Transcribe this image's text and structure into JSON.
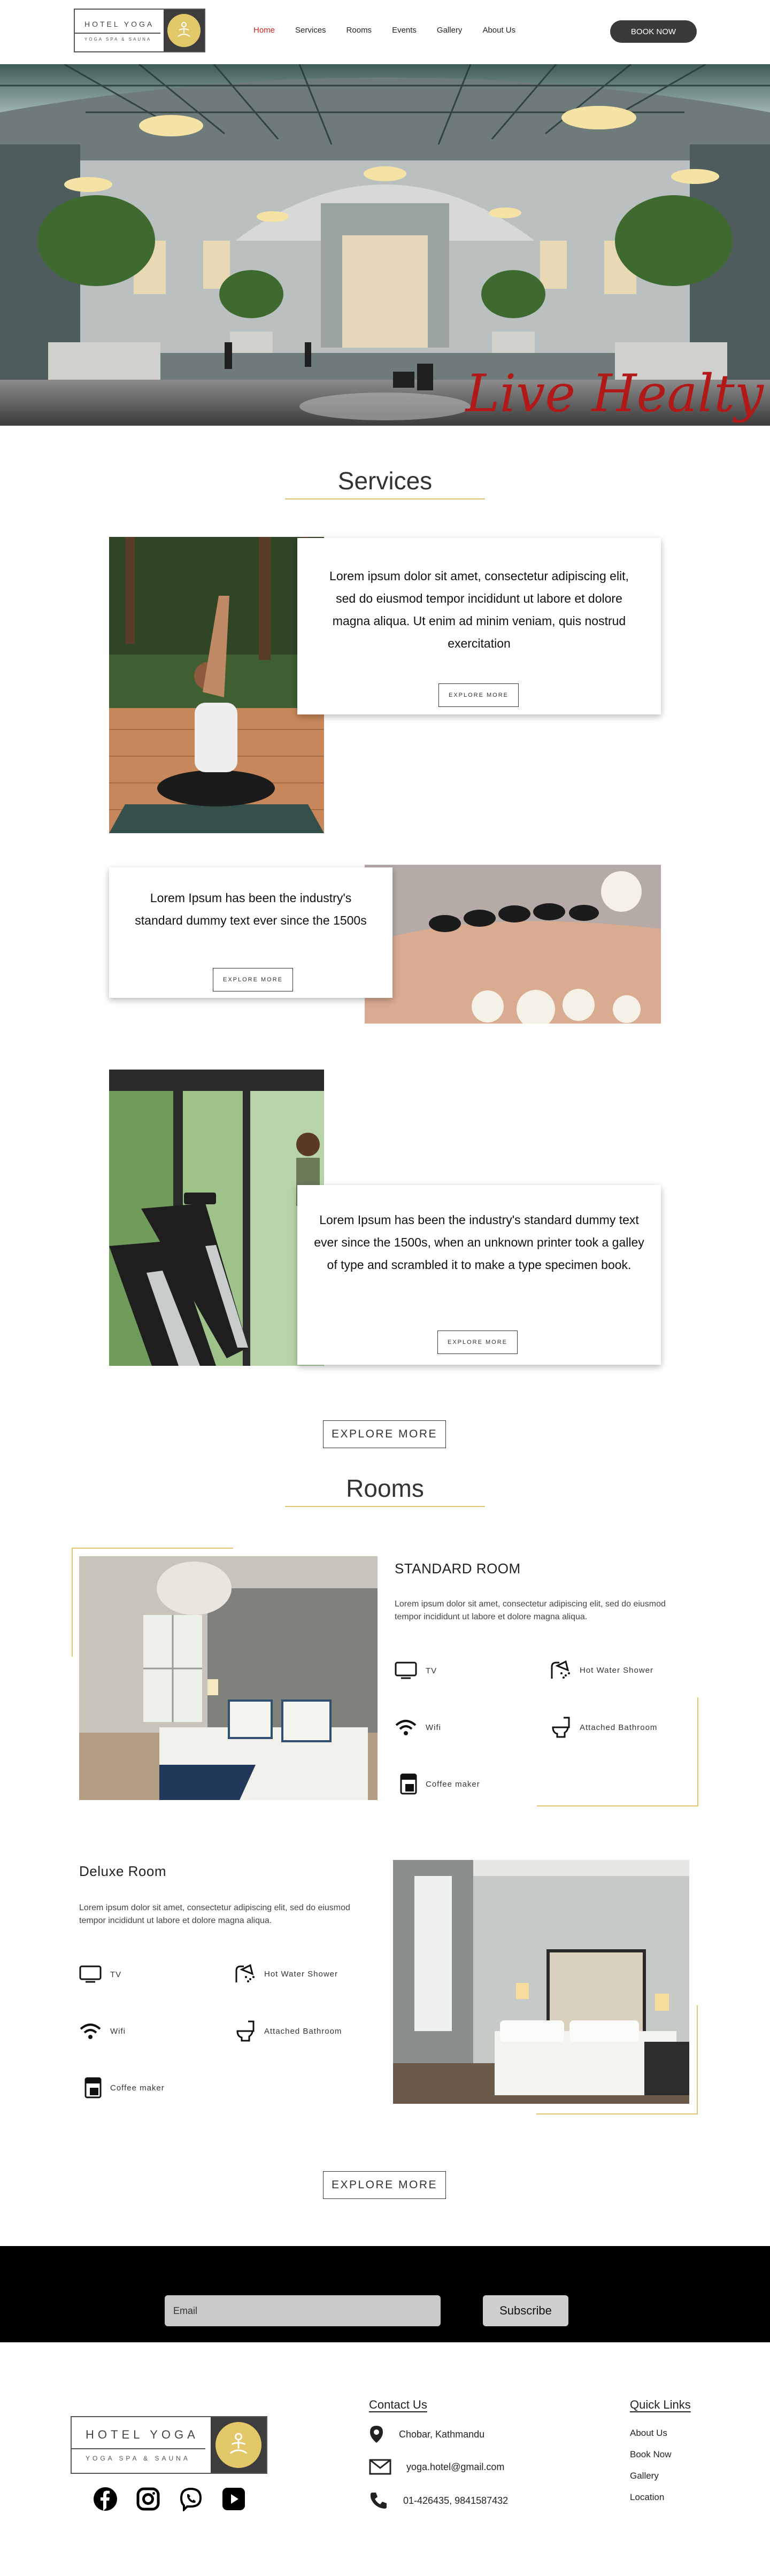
{
  "brand": {
    "name": "HOTEL YOGA",
    "tagline": "YOGA SPA & SAUNA",
    "badge_color": "#e3c86a"
  },
  "nav": {
    "items": [
      {
        "label": "Home",
        "active": true
      },
      {
        "label": "Services",
        "active": false
      },
      {
        "label": "Rooms",
        "active": false
      },
      {
        "label": "Events",
        "active": false
      },
      {
        "label": "Gallery",
        "active": false
      },
      {
        "label": "About Us",
        "active": false
      }
    ],
    "book_now": "BOOK NOW"
  },
  "hero": {
    "tagline": "Live Healty",
    "tagline_color": "#b11818"
  },
  "services": {
    "title": "Services",
    "items": [
      {
        "text": "Lorem ipsum dolor sit amet, consectetur adipiscing elit, sed do eiusmod tempor incididunt ut labore et dolore magna aliqua. Ut enim ad minim veniam, quis nostrud exercitation",
        "button": "EXPLORE MORE",
        "image": "yoga-pose-photo"
      },
      {
        "text": "Lorem Ipsum has been the industry's standard dummy text ever since the 1500s",
        "button": "EXPLORE MORE",
        "image": "hot-stone-massage-photo"
      },
      {
        "text": "Lorem Ipsum has been the industry's standard dummy text ever since the 1500s, when an unknown printer took a galley of type and scrambled it to make a type specimen book.",
        "button": "EXPLORE MORE",
        "image": "gym-treadmill-photo"
      }
    ],
    "explore_more": "EXPLORE MORE"
  },
  "rooms": {
    "title": "Rooms",
    "standard": {
      "title": "STANDARD ROOM",
      "desc": "Lorem ipsum dolor sit amet, consectetur adipiscing elit, sed do eiusmod tempor incididunt ut labore et dolore magna aliqua.",
      "amenities": {
        "tv": "TV",
        "shower": "Hot Water Shower",
        "wifi": "Wifi",
        "bathroom": "Attached Bathroom",
        "coffee": "Coffee maker"
      }
    },
    "deluxe": {
      "title": "Deluxe Room",
      "desc": "Lorem ipsum dolor sit amet, consectetur adipiscing elit, sed do eiusmod tempor incididunt ut labore et dolore magna aliqua.",
      "amenities": {
        "tv": "TV",
        "shower": "Hot Water Shower",
        "wifi": "Wifi",
        "bathroom": "Attached Bathroom",
        "coffee": "Coffee maker"
      }
    },
    "explore_more": "EXPLORE MORE",
    "accent_color": "#e2c572"
  },
  "newsletter": {
    "email_placeholder": "Email",
    "subscribe": "Subscribe"
  },
  "footer": {
    "social": [
      "facebook-icon",
      "instagram-icon",
      "viber-icon",
      "youtube-icon"
    ],
    "contact": {
      "title": "Contact Us",
      "address": "Chobar, Kathmandu",
      "email": "yoga.hotel@gmail.com",
      "phone": "01-426435, 9841587432"
    },
    "quick_links": {
      "title": "Quick Links",
      "items": [
        "About Us",
        "Book Now",
        "Gallery",
        "Location"
      ]
    }
  }
}
